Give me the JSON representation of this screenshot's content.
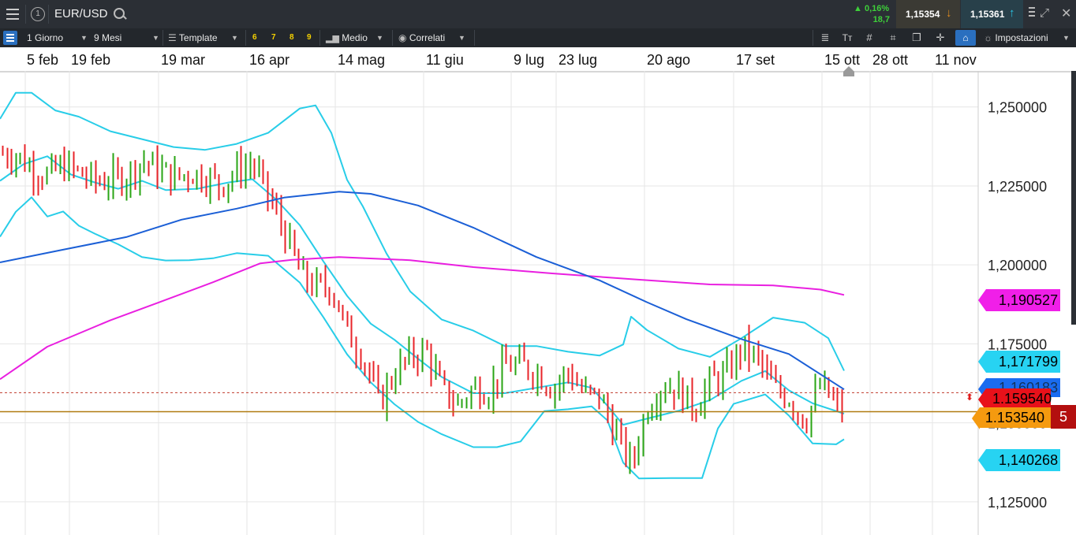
{
  "header": {
    "instrument": "EUR/USD",
    "change_pct": "0,16%",
    "change_pts": "18,7",
    "sell_price": "1,15354",
    "buy_price": "1,15361"
  },
  "toolbar": {
    "interval": "1 Giorno",
    "range": "9 Mesi",
    "template": "Template",
    "slots": [
      "6",
      "7",
      "8",
      "9"
    ],
    "average": "Medio",
    "related": "Correlati",
    "settings": "Impostazioni"
  },
  "chart_data": {
    "type": "candlestick",
    "x_tick_labels": [
      "5 feb",
      "19 feb",
      "19 mar",
      "16 apr",
      "14 mag",
      "11 giu",
      "9 lug",
      "23 lug",
      "20 ago",
      "17 set",
      "15 ott",
      "28 ott",
      "11 nov"
    ],
    "y_tick_labels": [
      "1,250000",
      "1,225000",
      "1,200000",
      "1,175000",
      "1,150000",
      "1,125000"
    ],
    "ylim": [
      1.1145,
      1.2614
    ],
    "price_markers": {
      "upper_band": "1,171799",
      "ma_magenta": "1,190527",
      "ma_blue": "1,160183",
      "last_close": "1.159540",
      "current": "1.153540",
      "lower_band": "1,140268",
      "dark_red_tag": "5"
    },
    "series": [
      {
        "name": "ma_magenta",
        "color": "#e91fe0",
        "values": [
          [
            0,
            1.1638
          ],
          [
            60,
            1.1741
          ],
          [
            140,
            1.1825
          ],
          [
            200,
            1.188
          ],
          [
            270,
            1.1945
          ],
          [
            330,
            1.2005
          ],
          [
            370,
            1.2016
          ],
          [
            430,
            1.2025
          ],
          [
            520,
            1.2015
          ],
          [
            600,
            1.1993
          ],
          [
            700,
            1.1973
          ],
          [
            800,
            1.1955
          ],
          [
            900,
            1.1938
          ],
          [
            980,
            1.1935
          ],
          [
            1040,
            1.1922
          ],
          [
            1070,
            1.1905
          ]
        ]
      },
      {
        "name": "ma_blue",
        "color": "#1b5fd6",
        "values": [
          [
            0,
            1.2008
          ],
          [
            80,
            1.2048
          ],
          [
            160,
            1.2088
          ],
          [
            230,
            1.2143
          ],
          [
            300,
            1.2178
          ],
          [
            360,
            1.2213
          ],
          [
            430,
            1.2232
          ],
          [
            470,
            1.2225
          ],
          [
            530,
            1.2188
          ],
          [
            600,
            1.2118
          ],
          [
            680,
            1.2025
          ],
          [
            760,
            1.1951
          ],
          [
            820,
            1.1882
          ],
          [
            870,
            1.1828
          ],
          [
            940,
            1.1765
          ],
          [
            1000,
            1.1718
          ],
          [
            1070,
            1.1606
          ]
        ]
      },
      {
        "name": "bb_upper",
        "color": "#28cde8",
        "values": [
          [
            0,
            1.2462
          ],
          [
            20,
            1.2545
          ],
          [
            40,
            1.2545
          ],
          [
            70,
            1.2489
          ],
          [
            100,
            1.2469
          ],
          [
            140,
            1.2423
          ],
          [
            180,
            1.2398
          ],
          [
            220,
            1.2373
          ],
          [
            260,
            1.2364
          ],
          [
            300,
            1.2383
          ],
          [
            340,
            1.2418
          ],
          [
            380,
            1.2495
          ],
          [
            400,
            1.2505
          ],
          [
            420,
            1.2418
          ],
          [
            440,
            1.2269
          ],
          [
            460,
            1.2185
          ],
          [
            490,
            1.2036
          ],
          [
            520,
            1.1916
          ],
          [
            560,
            1.1827
          ],
          [
            600,
            1.1792
          ],
          [
            640,
            1.1743
          ],
          [
            680,
            1.1743
          ],
          [
            720,
            1.1725
          ],
          [
            760,
            1.1713
          ],
          [
            790,
            1.1748
          ],
          [
            800,
            1.1836
          ],
          [
            820,
            1.1794
          ],
          [
            860,
            1.1735
          ],
          [
            900,
            1.1709
          ],
          [
            940,
            1.1768
          ],
          [
            980,
            1.1833
          ],
          [
            1020,
            1.1817
          ],
          [
            1050,
            1.1768
          ],
          [
            1070,
            1.1665
          ]
        ]
      },
      {
        "name": "bb_middle",
        "color": "#28cde8",
        "values": [
          [
            0,
            1.2266
          ],
          [
            30,
            1.2319
          ],
          [
            60,
            1.2344
          ],
          [
            90,
            1.2286
          ],
          [
            120,
            1.2261
          ],
          [
            150,
            1.2241
          ],
          [
            180,
            1.2266
          ],
          [
            210,
            1.2237
          ],
          [
            250,
            1.2241
          ],
          [
            290,
            1.2261
          ],
          [
            320,
            1.2271
          ],
          [
            350,
            1.2207
          ],
          [
            380,
            1.2126
          ],
          [
            410,
            1.2011
          ],
          [
            440,
            1.1902
          ],
          [
            470,
            1.1814
          ],
          [
            500,
            1.1763
          ],
          [
            530,
            1.1703
          ],
          [
            560,
            1.1645
          ],
          [
            600,
            1.1594
          ],
          [
            640,
            1.1594
          ],
          [
            680,
            1.1611
          ],
          [
            720,
            1.1628
          ],
          [
            750,
            1.1611
          ],
          [
            770,
            1.1554
          ],
          [
            790,
            1.1494
          ],
          [
            820,
            1.1513
          ],
          [
            860,
            1.1538
          ],
          [
            900,
            1.1572
          ],
          [
            940,
            1.1633
          ],
          [
            970,
            1.1664
          ],
          [
            1000,
            1.1603
          ],
          [
            1030,
            1.1562
          ],
          [
            1070,
            1.1529
          ]
        ]
      },
      {
        "name": "bb_lower",
        "color": "#28cde8",
        "values": [
          [
            0,
            1.2089
          ],
          [
            20,
            1.2168
          ],
          [
            40,
            1.2214
          ],
          [
            60,
            1.2153
          ],
          [
            80,
            1.2169
          ],
          [
            100,
            1.2124
          ],
          [
            120,
            1.2099
          ],
          [
            150,
            1.2065
          ],
          [
            180,
            1.2025
          ],
          [
            210,
            1.2014
          ],
          [
            240,
            1.2015
          ],
          [
            270,
            1.2021
          ],
          [
            300,
            1.2037
          ],
          [
            340,
            1.2029
          ],
          [
            380,
            1.1944
          ],
          [
            410,
            1.1834
          ],
          [
            440,
            1.1717
          ],
          [
            470,
            1.1628
          ],
          [
            500,
            1.1559
          ],
          [
            530,
            1.1503
          ],
          [
            560,
            1.1464
          ],
          [
            600,
            1.1423
          ],
          [
            630,
            1.1423
          ],
          [
            660,
            1.1441
          ],
          [
            690,
            1.1537
          ],
          [
            720,
            1.1543
          ],
          [
            750,
            1.1552
          ],
          [
            770,
            1.1508
          ],
          [
            790,
            1.1374
          ],
          [
            810,
            1.1324
          ],
          [
            850,
            1.1325
          ],
          [
            890,
            1.1325
          ],
          [
            910,
            1.1482
          ],
          [
            930,
            1.156
          ],
          [
            970,
            1.159
          ],
          [
            1000,
            1.1523
          ],
          [
            1030,
            1.1435
          ],
          [
            1060,
            1.1432
          ],
          [
            1070,
            1.1448
          ]
        ]
      },
      {
        "name": "price_path",
        "color": "#2aa515",
        "values": [
          [
            0,
            1.2352
          ],
          [
            20,
            1.2349
          ],
          [
            40,
            1.2306
          ],
          [
            60,
            1.2282
          ],
          [
            80,
            1.2315
          ],
          [
            100,
            1.229
          ],
          [
            120,
            1.2264
          ],
          [
            140,
            1.2268
          ],
          [
            160,
            1.2281
          ],
          [
            180,
            1.2331
          ],
          [
            200,
            1.2301
          ],
          [
            220,
            1.2276
          ],
          [
            240,
            1.2291
          ],
          [
            260,
            1.228
          ],
          [
            280,
            1.2253
          ],
          [
            300,
            1.23
          ],
          [
            320,
            1.2322
          ],
          [
            340,
            1.2213
          ],
          [
            360,
            1.2107
          ],
          [
            380,
            1.1971
          ],
          [
            400,
            1.1929
          ],
          [
            420,
            1.1931
          ],
          [
            440,
            1.1785
          ],
          [
            460,
            1.1711
          ],
          [
            480,
            1.1564
          ],
          [
            500,
            1.1659
          ],
          [
            520,
            1.171
          ],
          [
            540,
            1.1728
          ],
          [
            560,
            1.1602
          ],
          [
            580,
            1.1558
          ],
          [
            600,
            1.1611
          ],
          [
            620,
            1.1605
          ],
          [
            640,
            1.1681
          ],
          [
            660,
            1.1682
          ],
          [
            680,
            1.1662
          ],
          [
            700,
            1.161
          ],
          [
            720,
            1.1663
          ],
          [
            740,
            1.1592
          ],
          [
            760,
            1.1582
          ],
          [
            780,
            1.1468
          ],
          [
            800,
            1.1363
          ],
          [
            820,
            1.1552
          ],
          [
            840,
            1.1623
          ],
          [
            860,
            1.1602
          ],
          [
            880,
            1.1549
          ],
          [
            900,
            1.1629
          ],
          [
            920,
            1.1651
          ],
          [
            940,
            1.174
          ],
          [
            960,
            1.1702
          ],
          [
            980,
            1.161
          ],
          [
            1000,
            1.158
          ],
          [
            1020,
            1.1505
          ],
          [
            1040,
            1.162
          ],
          [
            1060,
            1.1553
          ],
          [
            1070,
            1.1535
          ]
        ]
      }
    ],
    "grid": true,
    "y_axis_position": "right"
  }
}
